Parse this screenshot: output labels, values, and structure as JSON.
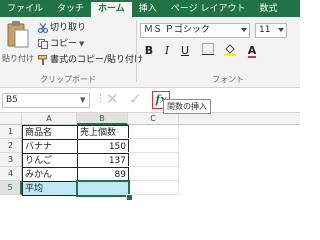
{
  "tabs": [
    {
      "label": "ファイル"
    },
    {
      "label": "タッチ"
    },
    {
      "label": "ホーム"
    },
    {
      "label": "挿入"
    },
    {
      "label": "ページ レイアウト"
    },
    {
      "label": "数式"
    }
  ],
  "clipboard": {
    "paste_label": "貼り付け",
    "cut_label": "切り取り",
    "copy_label": "コピー",
    "format_painter_label": "書式のコピー/貼り付け",
    "group_label": "クリップボード"
  },
  "font_group": {
    "font_name": "ＭＳ Ｐゴシック",
    "font_size": "11",
    "group_label": "フォント"
  },
  "formula_bar": {
    "name_box": "B5",
    "fx_label": "fx",
    "tooltip": "関数の挿入"
  },
  "grid": {
    "columns": [
      "A",
      "B",
      "C"
    ],
    "rows": [
      "1",
      "2",
      "3",
      "4",
      "5"
    ],
    "cells": [
      [
        "商品名",
        "売上個数",
        ""
      ],
      [
        "バナナ",
        "150",
        ""
      ],
      [
        "りんご",
        "137",
        ""
      ],
      [
        "みかん",
        "89",
        ""
      ],
      [
        "平均",
        "",
        ""
      ]
    ]
  },
  "colors": {
    "accent": "#217346",
    "highlight": "#bde7f4",
    "fx_border": "#e03030"
  }
}
